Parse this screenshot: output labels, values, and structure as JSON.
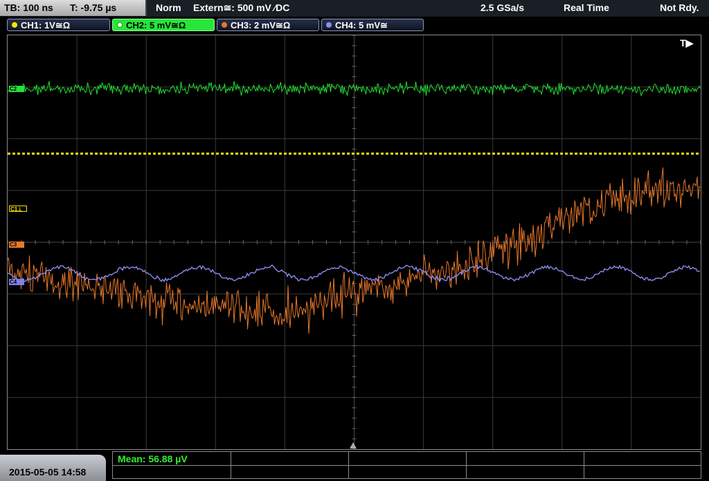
{
  "topbar": {
    "timebase": "TB: 100 ns",
    "trigger_time": "T: -9.75 µs",
    "trigger_mode": "Norm",
    "trigger_source": "Extern≅: 500 mV ⁄DC",
    "sample_rate": "2.5 GSa/s",
    "acq_mode": "Real Time",
    "status": "Not Rdy."
  },
  "channels": [
    {
      "label": "CH1: 1V≅Ω",
      "color": "#f5e60a",
      "active": false
    },
    {
      "label": "CH2: 5 mV≅Ω",
      "color": "#26e03a",
      "active": true
    },
    {
      "label": "CH3: 2 mV≅Ω",
      "color": "#e8782a",
      "active": false
    },
    {
      "label": "CH4: 5 mV≅",
      "color": "#8c8cf0",
      "active": false
    }
  ],
  "markers": {
    "c1": "C1⊥",
    "c2": "C2",
    "c3": "C3",
    "c4": "C4"
  },
  "trigger_indicator": "T▶",
  "datetime": "2015-05-05 14:58",
  "measurement": "Mean: 56.88 µV"
}
